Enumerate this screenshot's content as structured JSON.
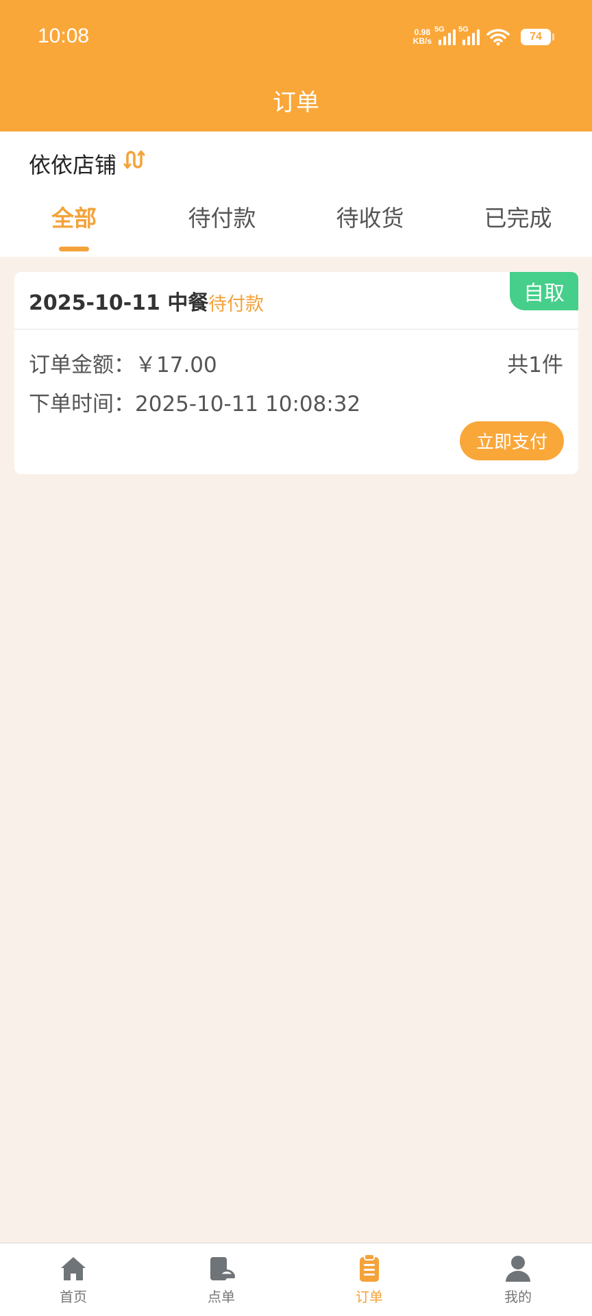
{
  "status_bar": {
    "time": "10:08",
    "net_speed_value": "0.98",
    "net_speed_unit": "KB/s",
    "sim1_label": "5G",
    "sim2_label": "5G",
    "battery": "74"
  },
  "header": {
    "title": "订单"
  },
  "store": {
    "name": "依依店铺",
    "switch_icon": "switch-arrows-icon"
  },
  "tabs": [
    {
      "label": "全部",
      "active": true
    },
    {
      "label": "待付款",
      "active": false
    },
    {
      "label": "待收货",
      "active": false
    },
    {
      "label": "已完成",
      "active": false
    }
  ],
  "orders": [
    {
      "title": "2025-10-11 中餐",
      "status": "待付款",
      "badge": "自取",
      "amount_label": "订单金额：",
      "amount": "￥17.00",
      "count": "共1件",
      "time_label": "下单时间：",
      "time": "2025-10-11 10:08:32",
      "pay_label": "立即支付"
    }
  ],
  "bottom_nav": [
    {
      "label": "首页",
      "icon": "home-icon"
    },
    {
      "label": "点单",
      "icon": "menu-order-icon"
    },
    {
      "label": "订单",
      "icon": "clipboard-icon",
      "active": true
    },
    {
      "label": "我的",
      "icon": "user-icon"
    }
  ],
  "colors": {
    "brand": "#faa73a",
    "accent_text": "#f4a23a",
    "pickup_badge": "#45cf8a",
    "page_background": "#f9f1e9"
  }
}
